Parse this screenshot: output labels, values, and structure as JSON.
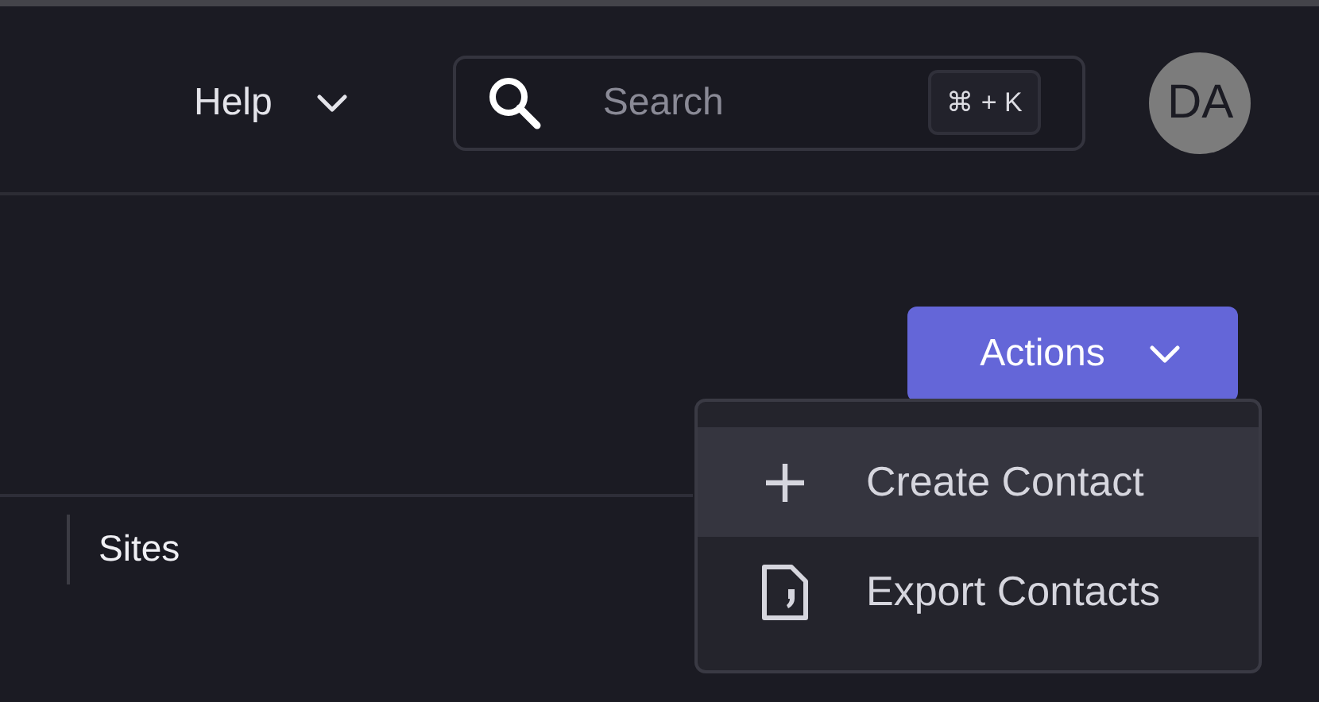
{
  "header": {
    "help_menu": {
      "label": "Help"
    },
    "search": {
      "placeholder": "Search",
      "shortcut": "⌘ + K"
    },
    "avatar": {
      "initials": "DA"
    }
  },
  "actions_button": {
    "label": "Actions",
    "expanded": true
  },
  "actions_menu": [
    {
      "label": "Create Contact",
      "kind": "plus",
      "selected": true
    },
    {
      "label": "Export Contacts",
      "kind": "file",
      "selected": false
    }
  ],
  "table": {
    "columns": [
      "Sites"
    ]
  }
}
